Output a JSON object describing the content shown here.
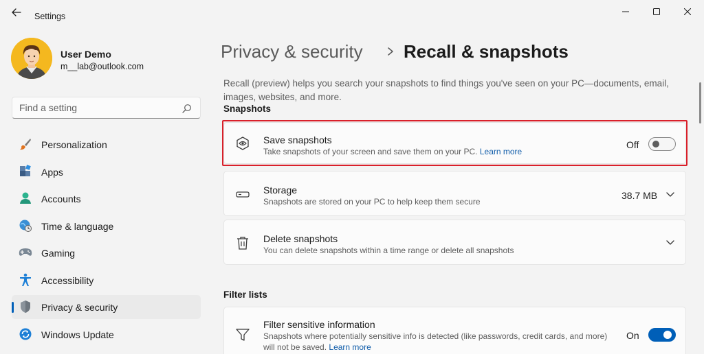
{
  "window": {
    "title": "Settings"
  },
  "user": {
    "name": "User Demo",
    "email": "m__lab@outlook.com"
  },
  "search": {
    "placeholder": "Find a setting"
  },
  "sidebar": {
    "items": [
      {
        "label": "Personalization",
        "icon": "brush-icon"
      },
      {
        "label": "Apps",
        "icon": "apps-icon"
      },
      {
        "label": "Accounts",
        "icon": "person-icon"
      },
      {
        "label": "Time & language",
        "icon": "globe-clock-icon"
      },
      {
        "label": "Gaming",
        "icon": "gamepad-icon"
      },
      {
        "label": "Accessibility",
        "icon": "accessibility-icon"
      },
      {
        "label": "Privacy & security",
        "icon": "shield-icon",
        "active": true
      },
      {
        "label": "Windows Update",
        "icon": "update-icon"
      }
    ]
  },
  "breadcrumb": {
    "parent": "Privacy & security",
    "current": "Recall & snapshots"
  },
  "main": {
    "description": "Recall (preview) helps you search your snapshots to find things you've seen on your PC—documents, email, images, websites, and more.",
    "snapshots_section": "Snapshots",
    "save_snapshots": {
      "title": "Save snapshots",
      "subtitle": "Take snapshots of your screen and save them on your PC.",
      "link": "Learn more",
      "state_label": "Off"
    },
    "storage": {
      "title": "Storage",
      "subtitle": "Snapshots are stored on your PC to help keep them secure",
      "value": "38.7 MB"
    },
    "delete_snapshots": {
      "title": "Delete snapshots",
      "subtitle": "You can delete snapshots within a time range or delete all snapshots"
    },
    "filter_section": "Filter lists",
    "filter_sensitive": {
      "title": "Filter sensitive information",
      "subtitle_line1": "Snapshots where potentially sensitive info is detected (like passwords, credit cards, and more)",
      "subtitle_line2": "will not be saved.",
      "link": "Learn more",
      "state_label": "On"
    }
  },
  "colors": {
    "accent": "#005fb8",
    "highlight": "#d9202a",
    "avatar_bg": "#f4b81f"
  }
}
